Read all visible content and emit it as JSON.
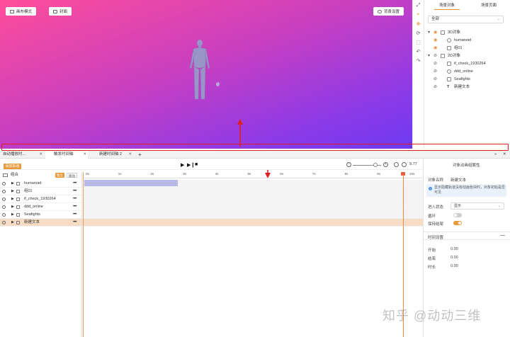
{
  "viewport": {
    "paint_mode_button": "画布模式",
    "cover_button": "封面",
    "background_button": "背景设置"
  },
  "scene_panel": {
    "tabs": [
      "场景对象",
      "场景页面"
    ],
    "filter_value": "全部",
    "tree": [
      {
        "label": "3D对象",
        "level": 0,
        "eye": "on"
      },
      {
        "label": "humanoid",
        "level": 1,
        "eye": "on"
      },
      {
        "label": "组01",
        "level": 1,
        "eye": "on"
      },
      {
        "label": "2D对象",
        "level": 0,
        "eye": "off"
      },
      {
        "label": "if_check_1930264",
        "level": 1,
        "eye": "off"
      },
      {
        "label": "ddd_online",
        "level": 1,
        "eye": "off"
      },
      {
        "label": "Seafights",
        "level": 1,
        "eye": "off"
      },
      {
        "label": "新建文本",
        "level": 1,
        "eye": "off"
      }
    ]
  },
  "timeline": {
    "tabs": [
      "自动播放时...",
      "触发时间轴",
      "新建时间轴 2"
    ],
    "add_tab": "+",
    "add_track_button": "添加轨道",
    "group_label": "组合",
    "chip_left": "独立",
    "chip_right": "联动",
    "time_value": "9.77",
    "ruler_labels": [
      "0s",
      "1s",
      "2s",
      "3s",
      "4s",
      "5s",
      "6s",
      "7s",
      "8s",
      "9s",
      "10s"
    ],
    "tracks": [
      {
        "label": "humanoid",
        "selected": false
      },
      {
        "label": "组01",
        "selected": false
      },
      {
        "label": "if_check_1930264",
        "selected": false
      },
      {
        "label": "ddd_online",
        "selected": false
      },
      {
        "label": "Seafights",
        "selected": false
      },
      {
        "label": "新建文本",
        "selected": true
      }
    ],
    "more": "•••"
  },
  "properties": {
    "title": "对象动画组属性",
    "object_name_label": "对象名称",
    "object_name_value": "新建文本",
    "notice": "显示隐藏轨道没有动画色块时，对象初始是否可见",
    "enter_state_label": "进入状态",
    "enter_state_value": "显示",
    "loop_label": "循环",
    "keep_label": "保持结尾",
    "loop_on": false,
    "keep_on": true,
    "time_section": "时间设置",
    "start_label": "开始",
    "start_value": "0.00",
    "end_label": "结束",
    "end_value": "0.00",
    "duration_label": "时长",
    "duration_value": "0.00"
  },
  "watermark": "知乎 @动动三维",
  "colors": {
    "accent": "#e99a3a",
    "annotation": "#e02020",
    "selected_row": "#f6dcc4",
    "clip": "#b7b8e6"
  }
}
